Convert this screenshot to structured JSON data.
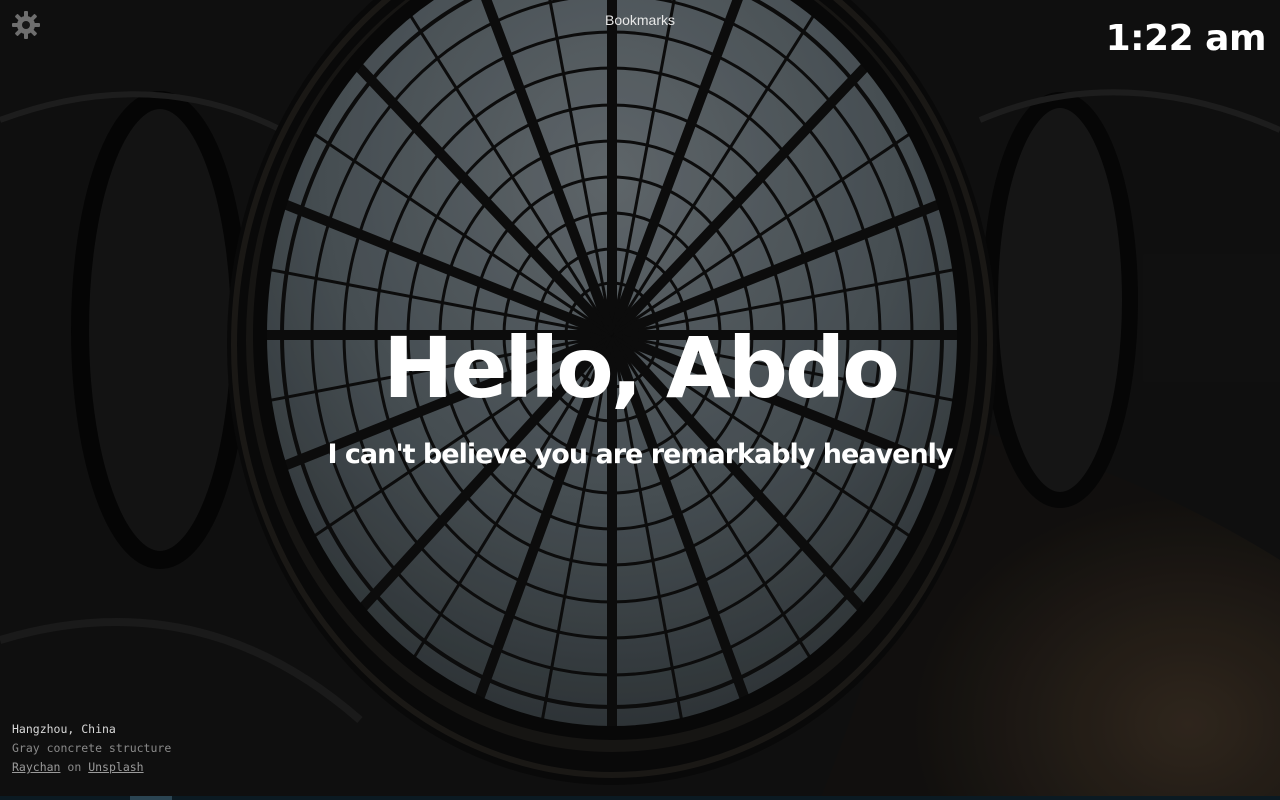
{
  "app": {
    "bookmarks_label": "Bookmarks",
    "clock": "1:22 am",
    "greeting": "Hello, Abdo",
    "compliment": "I can't believe you are remarkably heavenly"
  },
  "photo": {
    "location": "Hangzhou, China",
    "description": "Gray concrete structure",
    "author": "Raychan",
    "on_text": "on",
    "source": "Unsplash"
  },
  "icons": {
    "settings": "gear-icon"
  },
  "colors": {
    "text": "#ffffff",
    "muted": "#8a8a8a",
    "glass": "#4a545a",
    "frame": "#0a0a0a"
  }
}
